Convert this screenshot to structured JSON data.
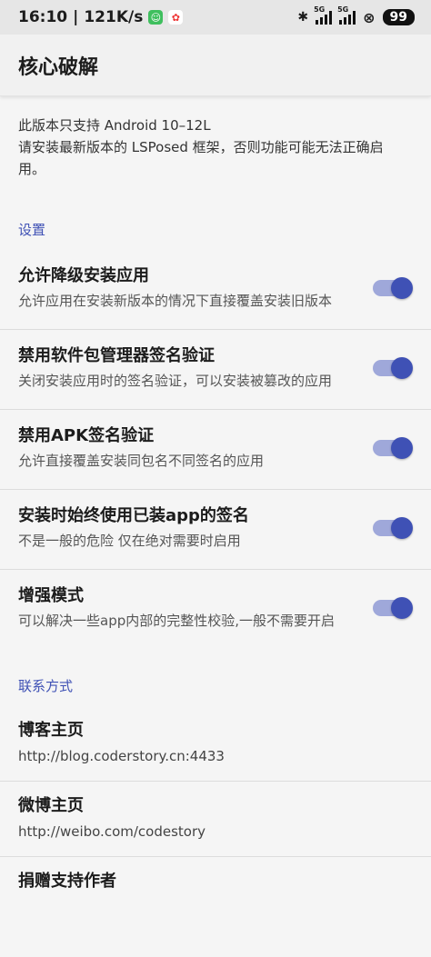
{
  "status": {
    "time": "16:10",
    "speed": "121K/s",
    "network": "5G",
    "battery": "99"
  },
  "header": {
    "title": "核心破解"
  },
  "notice": {
    "line1": "此版本只支持 Android 10–12L",
    "line2": "请安装最新版本的 LSPosed 框架，否则功能可能无法正确启用。"
  },
  "settings": {
    "header": "设置",
    "items": [
      {
        "title": "允许降级安装应用",
        "summary": "允许应用在安装新版本的情况下直接覆盖安装旧版本",
        "enabled": true
      },
      {
        "title": "禁用软件包管理器签名验证",
        "summary": "关闭安装应用时的签名验证，可以安装被篡改的应用",
        "enabled": true
      },
      {
        "title": "禁用APK签名验证",
        "summary": "允许直接覆盖安装同包名不同签名的应用",
        "enabled": true
      },
      {
        "title": "安装时始终使用已装app的签名",
        "summary": "不是一般的危险 仅在绝对需要时启用",
        "enabled": true
      },
      {
        "title": "增强模式",
        "summary": "可以解决一些app内部的完整性校验,一般不需要开启",
        "enabled": true
      }
    ]
  },
  "contact": {
    "header": "联系方式",
    "items": [
      {
        "title": "博客主页",
        "summary": "http://blog.coderstory.cn:4433"
      },
      {
        "title": "微博主页",
        "summary": "http://weibo.com/codestory"
      },
      {
        "title": "捐赠支持作者",
        "summary": ""
      }
    ]
  },
  "colors": {
    "accent": "#3f51b5",
    "switch_track": "#9fa8da"
  }
}
